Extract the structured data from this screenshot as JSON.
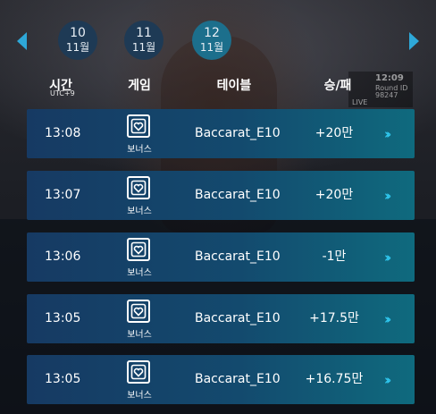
{
  "dates": [
    {
      "day": "10",
      "month": "11월",
      "active": false
    },
    {
      "day": "11",
      "month": "11월",
      "active": false
    },
    {
      "day": "12",
      "month": "11월",
      "active": true
    }
  ],
  "headers": {
    "time": "시간",
    "time_sub": "UTC+9",
    "game": "게임",
    "table": "테이블",
    "result": "승/패"
  },
  "rows": [
    {
      "time": "13:08",
      "game": "보너스",
      "table": "Baccarat_E10",
      "result": "+20만"
    },
    {
      "time": "13:07",
      "game": "보너스",
      "table": "Baccarat_E10",
      "result": "+20만"
    },
    {
      "time": "13:06",
      "game": "보너스",
      "table": "Baccarat_E10",
      "result": "-1만"
    },
    {
      "time": "13:05",
      "game": "보너스",
      "table": "Baccarat_E10",
      "result": "+17.5만"
    },
    {
      "time": "13:05",
      "game": "보너스",
      "table": "Baccarat_E10",
      "result": "+16.75만"
    }
  ],
  "background": {
    "clock": "12:09",
    "round": "Round ID",
    "round_num": "98247",
    "live": "LIVE"
  },
  "icons": {
    "prev": "chevron-left-icon",
    "next": "chevron-right-icon",
    "game": "bonus-card-icon",
    "detail": "double-chevron-right-icon"
  },
  "colors": {
    "accent": "#2ea8d8",
    "row_start": "#163a63",
    "row_end": "#0f6a7e",
    "date_active": "#1c6f8c",
    "date_inactive": "#1e3a55"
  }
}
